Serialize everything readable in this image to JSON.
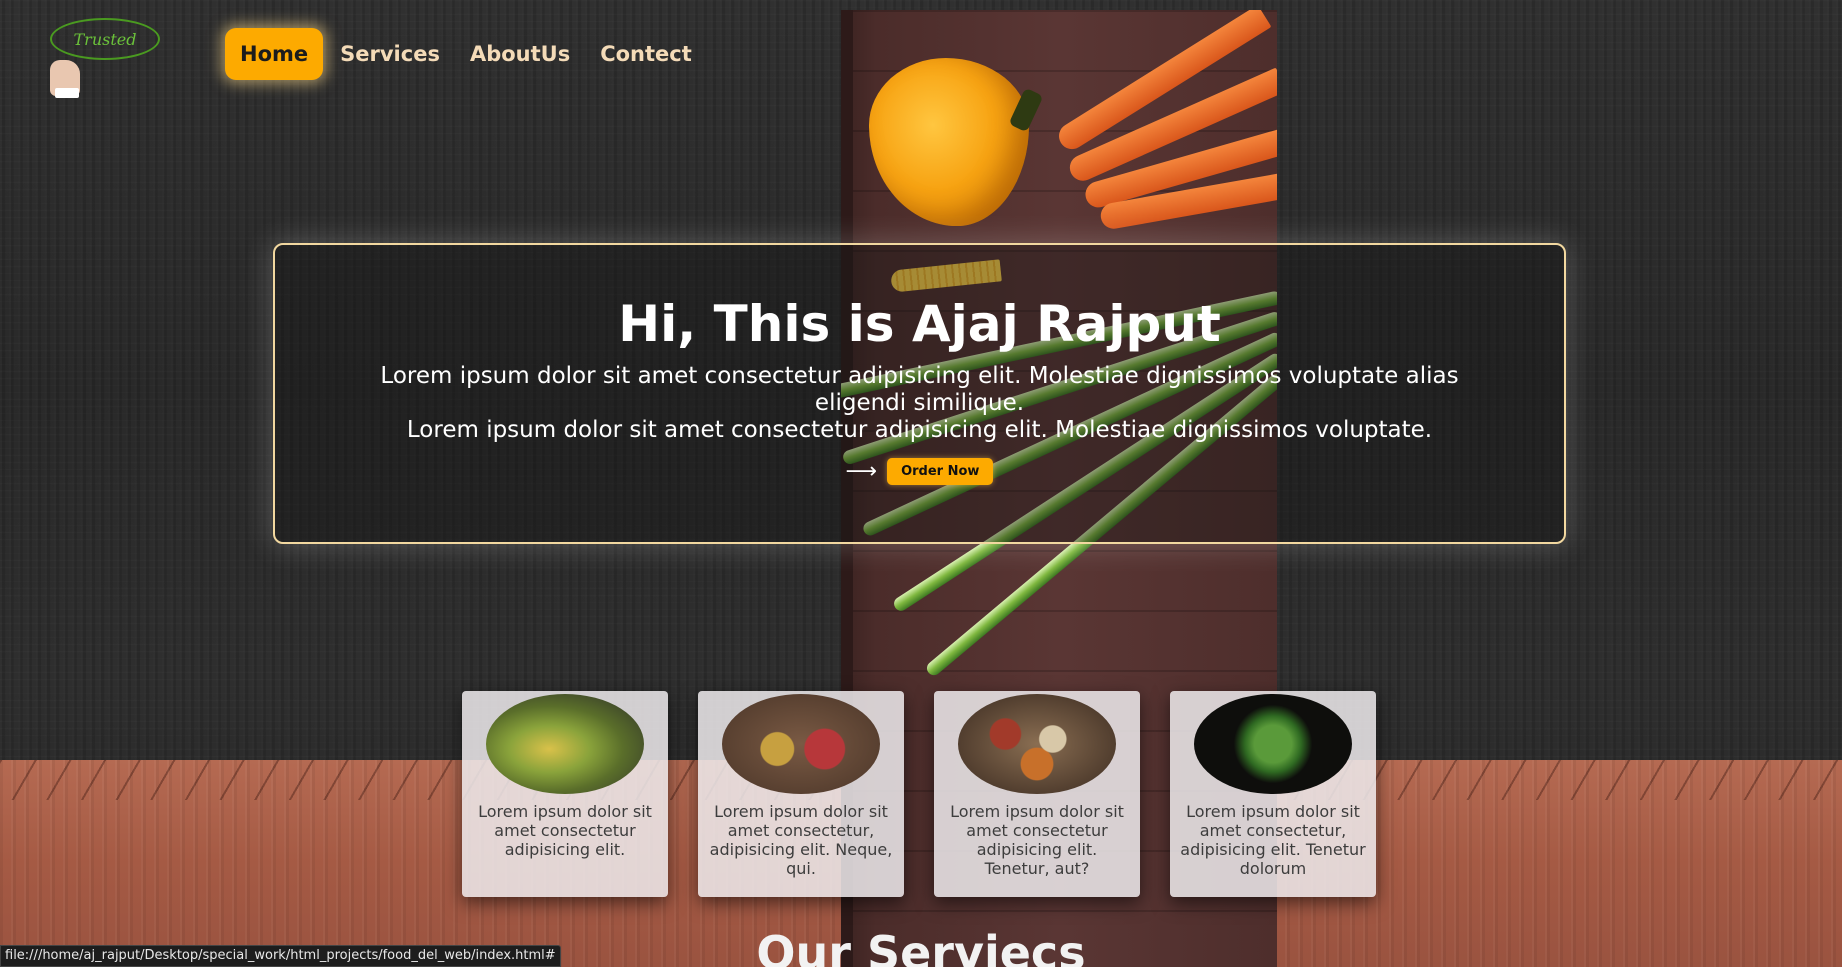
{
  "logo": {
    "text": "Trusted"
  },
  "nav": {
    "items": [
      {
        "label": "Home"
      },
      {
        "label": "Services"
      },
      {
        "label": "AboutUs"
      },
      {
        "label": "Contect"
      }
    ]
  },
  "hero": {
    "title": "Hi, This is Ajaj Rajput",
    "paragraph_1": "Lorem ipsum dolor sit amet consectetur adipisicing elit. Molestiae dignissimos voluptate alias eligendi similique.",
    "paragraph_2": "Lorem ipsum dolor sit amet consectetur adipisicing elit. Molestiae dignissimos voluptate.",
    "arrow": "⟶",
    "button_label": "Order Now"
  },
  "cards": [
    {
      "text": "Lorem ipsum dolor sit amet consectetur adipisicing elit."
    },
    {
      "text": "Lorem ipsum dolor sit amet consectetur, adipisicing elit. Neque, qui."
    },
    {
      "text": "Lorem ipsum dolor sit amet consectetur adipisicing elit. Tenetur, aut?"
    },
    {
      "text": "Lorem ipsum dolor sit amet consectetur, adipisicing elit. Tenetur dolorum"
    }
  ],
  "section_heading": "Our Serviecs",
  "status_bar": "file:///home/aj_rajput/Desktop/special_work/html_projects/food_del_web/index.html#",
  "colors": {
    "accent": "#fdaa00",
    "nav_text": "#f4dbb8",
    "hero_border": "#f2d8a0"
  }
}
